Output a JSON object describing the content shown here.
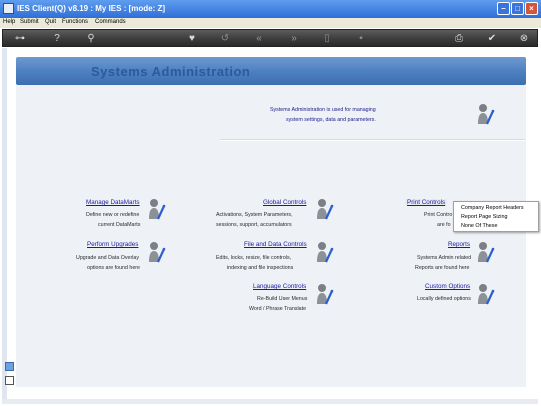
{
  "window": {
    "title": "IES Client(Q) v8.19 : My IES :    [mode: Z]"
  },
  "menu": [
    "Help",
    "Submit",
    "Quit",
    "Functions",
    "Commands"
  ],
  "toolbar": {
    "items": [
      "key-icon",
      "help-icon",
      "search-icon",
      "heart-icon",
      "undo-icon",
      "back-icon",
      "forward-icon",
      "document-icon",
      "save-icon",
      "print-icon",
      "check-icon",
      "close-icon"
    ]
  },
  "banner": {
    "title": "Systems Administration"
  },
  "intro": {
    "line1": "Systems Administration is used for managing",
    "line2": "system settings, data and parameters."
  },
  "sections": {
    "manage_datamarts": {
      "title": "Manage DataMarts",
      "line1": "Define new or redefine",
      "line2": "current DataMarts"
    },
    "global_controls": {
      "title": "Global Controls",
      "line1": "Activations, System Parameters,",
      "line2": "sessions, support, accumulators"
    },
    "print_controls": {
      "title": "Print Controls",
      "line1": "Print Contro",
      "line2": "are fo"
    },
    "perform_upgrades": {
      "title": "Perform Upgrades",
      "line1": "Upgrade and Data Overlay",
      "line2": "options are found here"
    },
    "file_data_controls": {
      "title": "File and Data Controls",
      "line1": "Edits, locks, resize, file controls,",
      "line2": "indexing and file inspections"
    },
    "reports": {
      "title": "Reports",
      "line1": "Systems Admin related",
      "line2": "Reports are found here"
    },
    "language_controls": {
      "title": "Language Controls",
      "line1": "Re-Build User Menus",
      "line2": "Word / Phrase Translate"
    },
    "custom_options": {
      "title": "Custom Options",
      "line1": "Locally defined options"
    }
  },
  "context_menu": {
    "items": [
      "Company Report Headers",
      "Report Page Sizing",
      "None Of These"
    ]
  },
  "colors": {
    "banner": "#4c7fc0",
    "link": "#1a1aa0",
    "titlebar": "#2f6fd6",
    "toolbar": "#3a3a3a"
  }
}
